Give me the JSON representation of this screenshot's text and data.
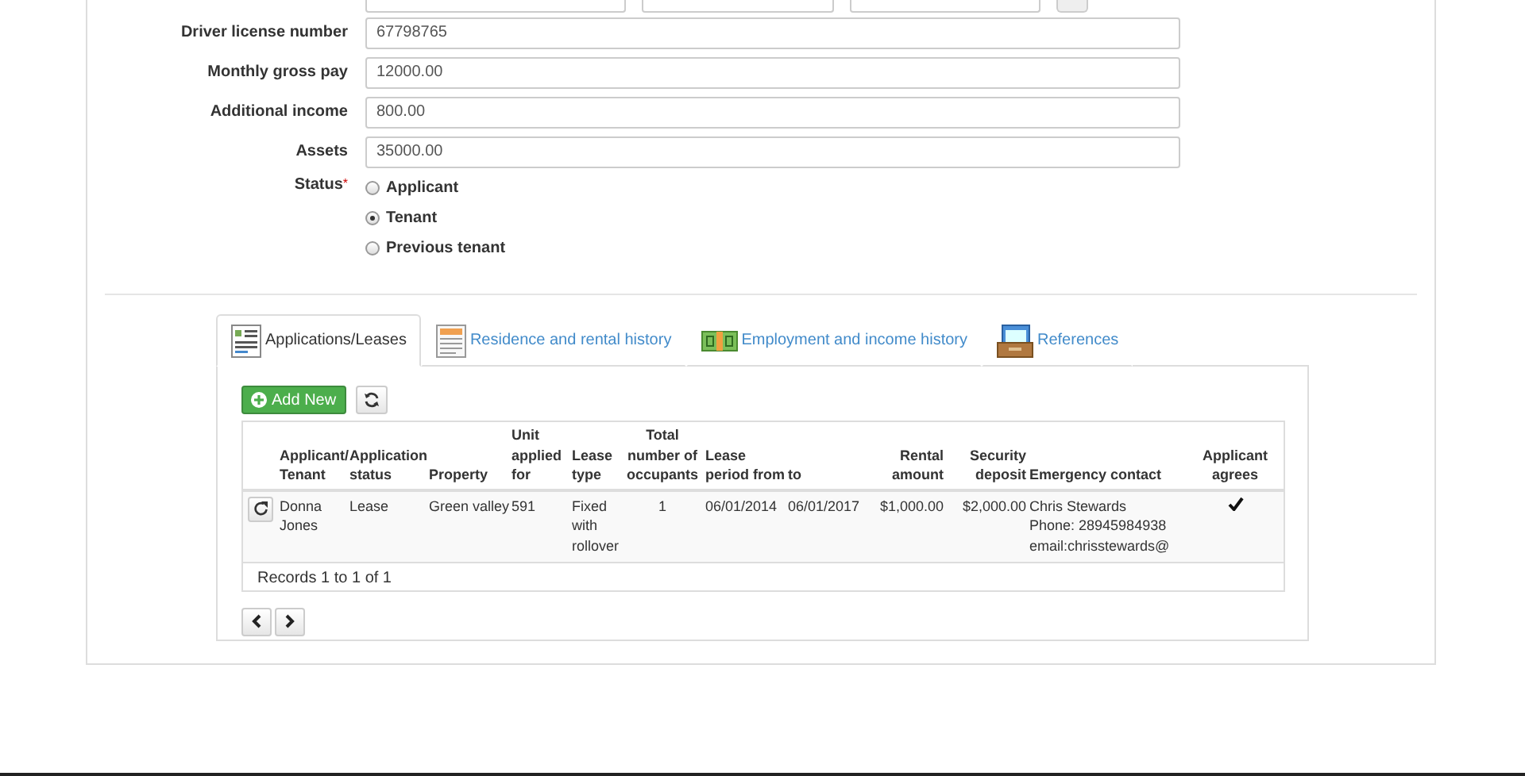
{
  "form": {
    "fields": [
      {
        "label": "Driver license number",
        "value": "67798765"
      },
      {
        "label": "Monthly gross pay",
        "value": "12000.00"
      },
      {
        "label": "Additional income",
        "value": "800.00"
      },
      {
        "label": "Assets",
        "value": "35000.00"
      }
    ],
    "status": {
      "label": "Status",
      "required_mark": "*",
      "options": [
        {
          "label": "Applicant",
          "selected": false
        },
        {
          "label": "Tenant",
          "selected": true
        },
        {
          "label": "Previous tenant",
          "selected": false
        }
      ]
    }
  },
  "tabs": [
    {
      "label": "Applications/Leases",
      "selected": true,
      "kind": "form"
    },
    {
      "label": "Residence and rental history",
      "selected": false,
      "kind": "document"
    },
    {
      "label": "Employment and income history",
      "selected": false,
      "kind": "money"
    },
    {
      "label": "References",
      "selected": false,
      "kind": "tray"
    }
  ],
  "toolbar": {
    "add_button": "Add New"
  },
  "table": {
    "columns": [
      "Applicant/ Tenant",
      "Application status",
      "Property",
      "Unit applied for",
      "Lease type",
      "Total number of occupants",
      "Lease period from",
      "to",
      "Rental amount",
      "Security deposit",
      "Emergency contact",
      "Applicant agrees"
    ],
    "rows": [
      {
        "cells": [
          "Donna Jones",
          "Lease",
          "Green valley",
          "591",
          "Fixed with rollover",
          "1",
          "06/01/2014",
          "06/01/2017",
          "$1,000.00",
          "$2,000.00"
        ],
        "contact": [
          "Chris Stewards",
          "Phone: 28945984938",
          "email:chrisstewards@"
        ],
        "agrees": true
      }
    ],
    "footer": "Records 1 to 1 of 1"
  }
}
